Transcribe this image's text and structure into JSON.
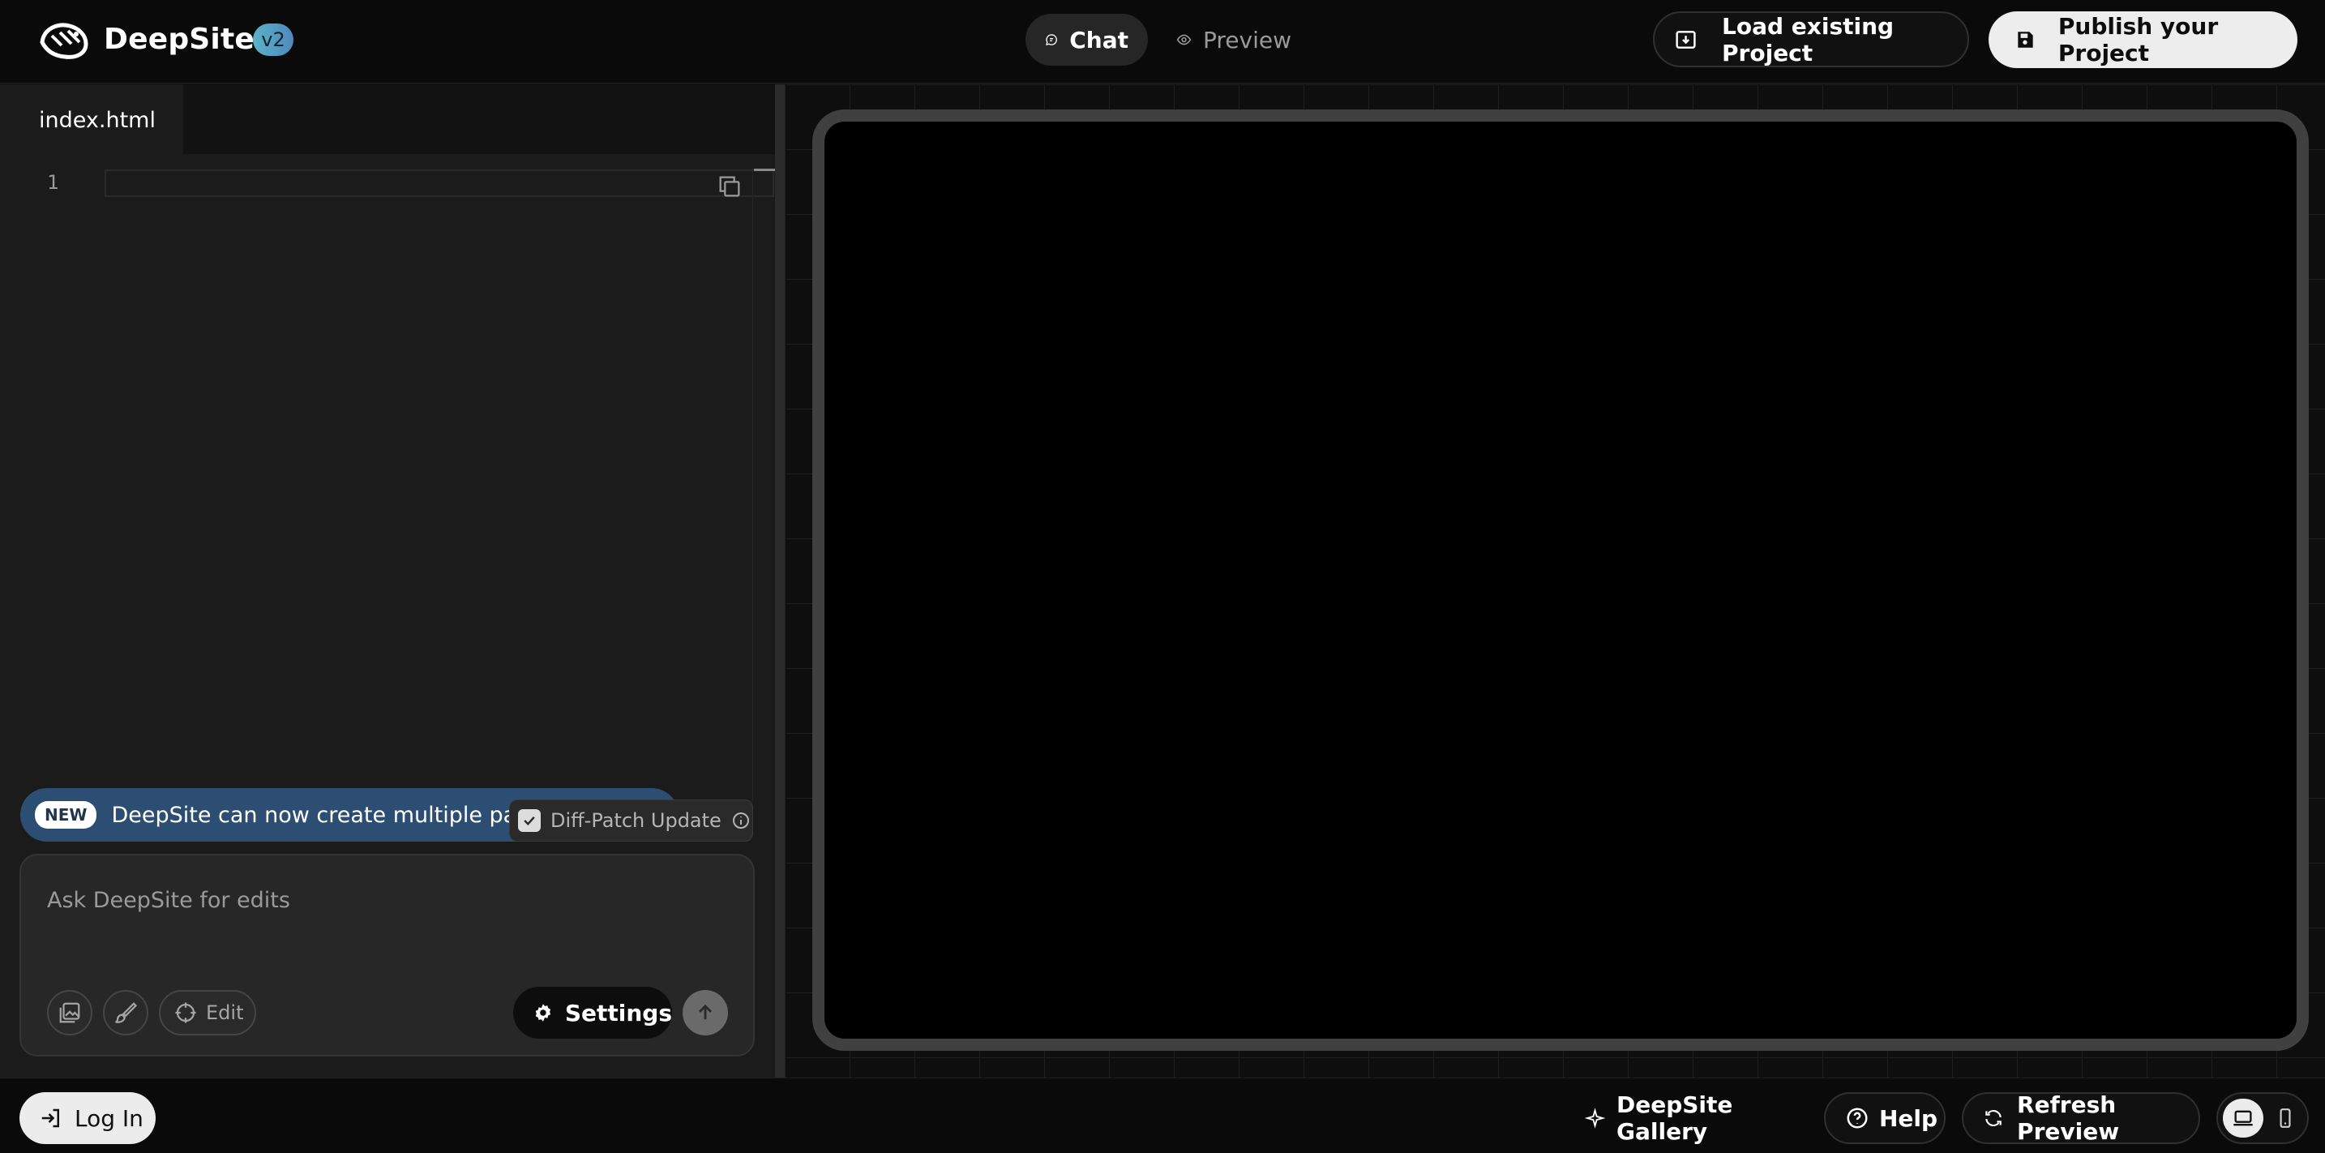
{
  "header": {
    "brand": "DeepSite",
    "version": "v2",
    "toggle": {
      "chat_label": "Chat",
      "preview_label": "Preview",
      "active": "Chat"
    },
    "load_label": "Load existing Project",
    "publish_label": "Publish your Project"
  },
  "editor": {
    "tabs": [
      {
        "label": "index.html",
        "active": true
      }
    ],
    "line_numbers": [
      "1"
    ]
  },
  "chat": {
    "banner": {
      "badge": "NEW",
      "text": "DeepSite can now create multiple pages"
    },
    "diff_patch": {
      "label": "Diff-Patch Update",
      "checked": true
    },
    "input_placeholder": "Ask DeepSite for edits",
    "edit_label": "Edit",
    "settings_label": "Settings"
  },
  "footer": {
    "login_label": "Log In",
    "gallery_label": "DeepSite Gallery",
    "help_label": "Help",
    "refresh_label": "Refresh Preview",
    "device_modes": [
      "desktop",
      "mobile"
    ],
    "active_device": "desktop"
  },
  "icons": {
    "logo": "whale-logo-icon",
    "chat": "chat-bubble-icon",
    "preview": "eye-icon",
    "load": "download-box-icon",
    "publish": "save-disk-icon",
    "copy": "copy-icon",
    "info": "info-icon",
    "image": "image-upload-icon",
    "brush": "paint-brush-icon",
    "crosshair": "crosshair-icon",
    "gear": "gear-icon",
    "send": "arrow-up-icon",
    "login": "login-arrow-icon",
    "sparkle": "sparkle-icon",
    "help": "question-circle-icon",
    "refresh": "refresh-icon",
    "desktop": "desktop-icon",
    "mobile": "mobile-icon"
  },
  "colors": {
    "background": "#0d0d0d",
    "panel": "#1b1b1b",
    "banner": "#2d4e73",
    "version_badge": "#5ab3c8",
    "device_frame": "#404040"
  }
}
